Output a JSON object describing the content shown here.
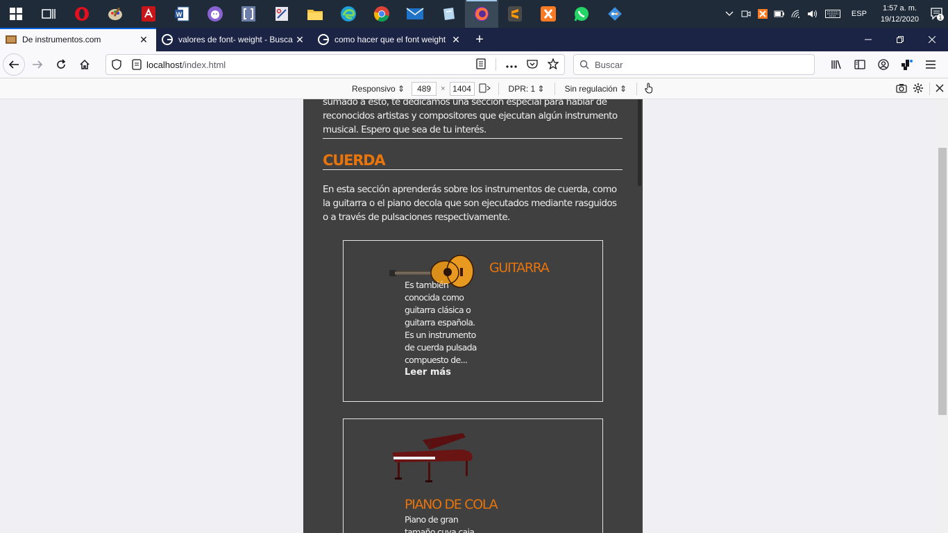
{
  "taskbar": {
    "apps": [
      "task-view",
      "opera",
      "paint",
      "acrobat",
      "word",
      "github-desktop",
      "brackets",
      "snipping",
      "file-explorer",
      "edge",
      "chrome",
      "mail",
      "notes",
      "firefox",
      "sublime",
      "xampp",
      "whatsapp",
      "git"
    ],
    "lang": "ESP",
    "time": "1:57 a. m.",
    "date": "19/12/2020",
    "notifications": "1"
  },
  "tabs": [
    {
      "label": "De instrumentos.com",
      "close": "✕"
    },
    {
      "label": "valores de font- weight - Buscar con Google",
      "close": "✕"
    },
    {
      "label": "como hacer que el font weight",
      "close": "✕"
    }
  ],
  "newtab": "+",
  "url": {
    "host": "localhost",
    "path": "/index.html"
  },
  "search": {
    "placeholder": "Buscar"
  },
  "rdm": {
    "device": "Responsivo ⇕",
    "width": "489",
    "times": "×",
    "height": "1404",
    "dpr": "DPR: 1 ⇕",
    "throttle": "Sin regulación ⇕"
  },
  "page": {
    "intro": "sumado a esto, te dedicamos una sección especial para hablar de reconocidos artistas y compositores que ejecutan algún instrumento musical. Espero que sea de tu interés.",
    "section_title": "CUERDA",
    "section_text": "En esta sección aprenderás sobre los instrumentos de cuerda, como la guitarra o el piano decola que son ejecutados mediante rasguidos o a través de pulsaciones respectivamente.",
    "cards": [
      {
        "title": "GUITARRA",
        "desc": "Es también conocida como guitarra clásica o guitarra española. Es un instrumento de cuerda pulsada compuesto de...",
        "more": "Leer más"
      },
      {
        "title": "PIANO DE COLA",
        "desc": "Piano de gran tamaño cuya caja"
      }
    ]
  }
}
